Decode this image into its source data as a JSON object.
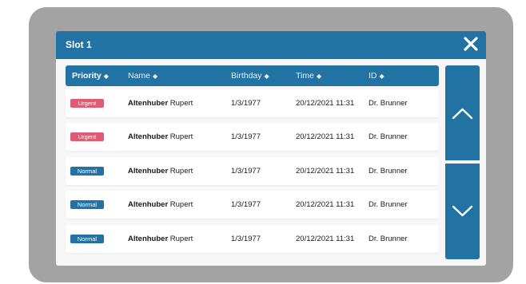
{
  "dialog": {
    "title": "Slot 1",
    "close_icon": "close-icon"
  },
  "table": {
    "columns": [
      {
        "label": "Priority",
        "sort_icon": "sort-icon"
      },
      {
        "label": "Name",
        "sort_icon": "sort-icon"
      },
      {
        "label": "Birthday",
        "sort_icon": "sort-icon"
      },
      {
        "label": "Time",
        "sort_icon": "sort-icon"
      },
      {
        "label": "ID",
        "sort_icon": "sort-icon"
      }
    ],
    "rows": [
      {
        "priority": "Urgent",
        "last_name": "Altenhuber",
        "first_name": "Rupert",
        "birthday": "1/3/1977",
        "time": "20/12/2021 11:31",
        "id": "Dr. Brunner"
      },
      {
        "priority": "Urgent",
        "last_name": "Altenhuber",
        "first_name": "Rupert",
        "birthday": "1/3/1977",
        "time": "20/12/2021 11:31",
        "id": "Dr. Brunner"
      },
      {
        "priority": "Normal",
        "last_name": "Altenhuber",
        "first_name": "Rupert",
        "birthday": "1/3/1977",
        "time": "20/12/2021 11:31",
        "id": "Dr. Brunner"
      },
      {
        "priority": "Normal",
        "last_name": "Altenhuber",
        "first_name": "Rupert",
        "birthday": "1/3/1977",
        "time": "20/12/2021 11:31",
        "id": "Dr. Brunner"
      },
      {
        "priority": "Normal",
        "last_name": "Altenhuber",
        "first_name": "Rupert",
        "birthday": "1/3/1977",
        "time": "20/12/2021 11:31",
        "id": "Dr. Brunner"
      }
    ]
  },
  "scroll": {
    "up_icon": "chevron-up-icon",
    "down_icon": "chevron-down-icon"
  },
  "colors": {
    "accent": "#2272a3",
    "urgent": "#e05a73",
    "normal": "#2272a3",
    "device_frame": "#a3a3a3"
  }
}
